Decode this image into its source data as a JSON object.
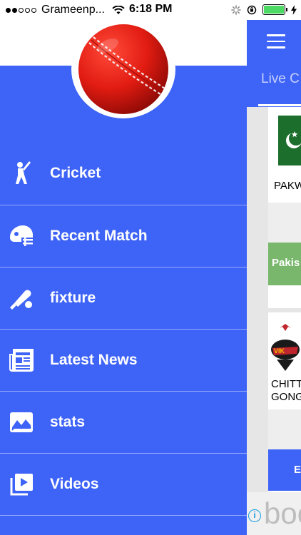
{
  "status_bar": {
    "carrier": "Grameenp...",
    "time": "6:18 PM",
    "signal_dots_filled": 2,
    "signal_dots_total": 5
  },
  "drawer": {
    "logo_icon": "cricket-ball-icon",
    "items": [
      {
        "label": "Cricket",
        "icon": "batsman-icon"
      },
      {
        "label": "Recent Match",
        "icon": "helmet-icon"
      },
      {
        "label": "fixture",
        "icon": "bat-ball-icon"
      },
      {
        "label": "Latest News",
        "icon": "newspaper-icon"
      },
      {
        "label": "stats",
        "icon": "chart-image-icon"
      },
      {
        "label": "Videos",
        "icon": "video-playlist-icon"
      }
    ]
  },
  "main": {
    "tab_label": "Live C",
    "card1": {
      "team_text": "PAKW",
      "result_text": "Pakis"
    },
    "card2": {
      "team_line1": "CHITT",
      "team_line2": "GONG",
      "button_text": "E"
    },
    "ad": {
      "info": "i",
      "text": "boo"
    }
  },
  "colors": {
    "primary_blue": "#3e63f7",
    "green": "#79b86c",
    "battery_green": "#4cd964"
  }
}
